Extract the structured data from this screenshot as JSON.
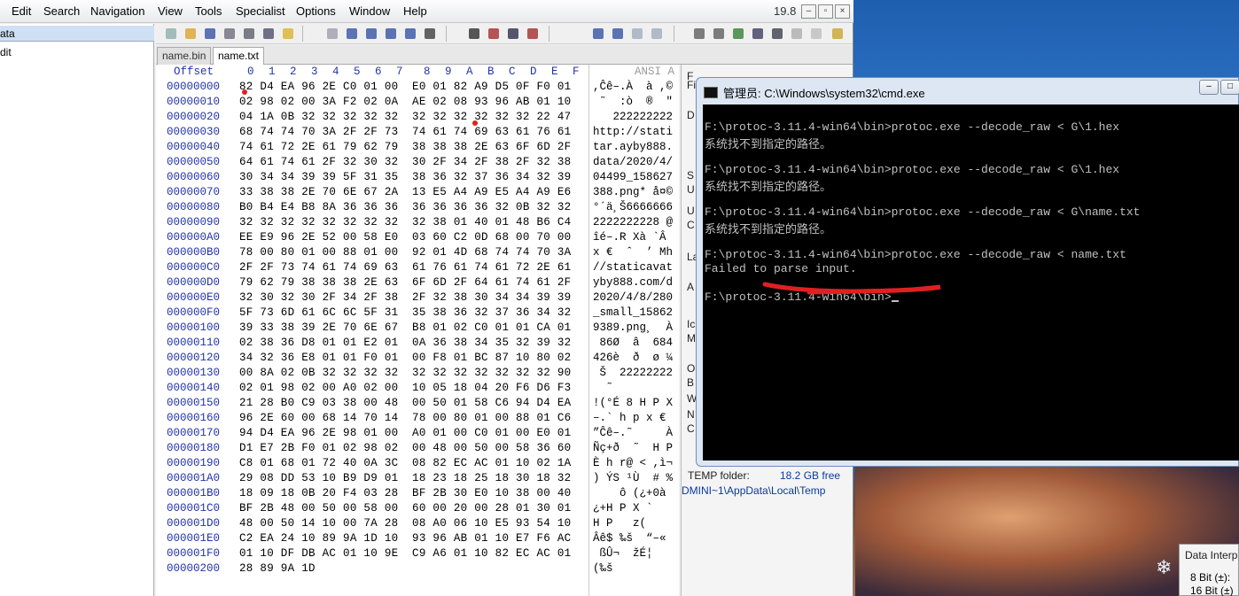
{
  "menu": [
    "Edit",
    "Search",
    "Navigation",
    "View",
    "Tools",
    "Specialist",
    "Options",
    "Window",
    "Help"
  ],
  "version": "19.8",
  "window_controls": [
    "–",
    "▫",
    "×"
  ],
  "left_panel": {
    "row1": "ata",
    "row2": "dit"
  },
  "tabs": [
    "name.bin",
    "name.txt"
  ],
  "hex": {
    "offset_header": "Offset",
    "column_headers": [
      "0",
      "1",
      "2",
      "3",
      "4",
      "5",
      "6",
      "7",
      "8",
      "9",
      "A",
      "B",
      "C",
      "D",
      "E",
      "F"
    ],
    "ansi_header": "ANSI A",
    "rows": [
      {
        "off": "00000000",
        "bytes": "82 D4 EA 96 2E C0 01 00  E0 01 82 A9 D5 0F F0 01",
        "ansi": ",Ĉê–.À  à ,©"
      },
      {
        "off": "00000010",
        "bytes": "02 98 02 00 3A F2 02 0A  AE 02 08 93 96 AB 01 10",
        "ansi": " ˜  :ò  ®  \""
      },
      {
        "off": "00000020",
        "bytes": "04 1A 0B 32 32 32 32 32  32 32 32 32 32 32 22 47",
        "ansi": "   222222222"
      },
      {
        "off": "00000030",
        "bytes": "68 74 74 70 3A 2F 2F 73  74 61 74 69 63 61 76 61",
        "ansi": "http://stati"
      },
      {
        "off": "00000040",
        "bytes": "74 61 72 2E 61 79 62 79  38 38 38 2E 63 6F 6D 2F",
        "ansi": "tar.ayby888."
      },
      {
        "off": "00000050",
        "bytes": "64 61 74 61 2F 32 30 32  30 2F 34 2F 38 2F 32 38",
        "ansi": "data/2020/4/"
      },
      {
        "off": "00000060",
        "bytes": "30 34 34 39 39 5F 31 35  38 36 32 37 36 34 32 39",
        "ansi": "04499_158627"
      },
      {
        "off": "00000070",
        "bytes": "33 38 38 2E 70 6E 67 2A  13 E5 A4 A9 E5 A4 A9 E6",
        "ansi": "388.png* å¤©"
      },
      {
        "off": "00000080",
        "bytes": "B0 B4 E4 B8 8A 36 36 36  36 36 36 36 32 0B 32 32",
        "ansi": "°´ä¸Š6666666"
      },
      {
        "off": "00000090",
        "bytes": "32 32 32 32 32 32 32 32  32 38 01 40 01 48 B6 C4",
        "ansi": "2222222228 @"
      },
      {
        "off": "000000A0",
        "bytes": "EE E9 96 2E 52 00 58 E0  03 60 C2 0D 68 00 70 00",
        "ansi": "îé–.R Xà `Â"
      },
      {
        "off": "000000B0",
        "bytes": "78 00 80 01 00 88 01 00  92 01 4D 68 74 74 70 3A",
        "ansi": "x €  ˆ  ’ Mh"
      },
      {
        "off": "000000C0",
        "bytes": "2F 2F 73 74 61 74 69 63  61 76 61 74 61 72 2E 61",
        "ansi": "//staticavat"
      },
      {
        "off": "000000D0",
        "bytes": "79 62 79 38 38 38 2E 63  6F 6D 2F 64 61 74 61 2F",
        "ansi": "yby888.com/d"
      },
      {
        "off": "000000E0",
        "bytes": "32 30 32 30 2F 34 2F 38  2F 32 38 30 34 34 39 39",
        "ansi": "2020/4/8/280"
      },
      {
        "off": "000000F0",
        "bytes": "5F 73 6D 61 6C 6C 5F 31  35 38 36 32 37 36 34 32",
        "ansi": "_small_15862"
      },
      {
        "off": "00000100",
        "bytes": "39 33 38 39 2E 70 6E 67  B8 01 02 C0 01 01 CA 01",
        "ansi": "9389.png¸  À"
      },
      {
        "off": "00000110",
        "bytes": "02 38 36 D8 01 01 E2 01  0A 36 38 34 35 32 39 32",
        "ansi": " 86Ø  â  684"
      },
      {
        "off": "00000120",
        "bytes": "34 32 36 E8 01 01 F0 01  00 F8 01 BC 87 10 80 02",
        "ansi": "426è  ð  ø ¼"
      },
      {
        "off": "00000130",
        "bytes": "00 8A 02 0B 32 32 32 32  32 32 32 32 32 32 32 90",
        "ansi": " Š  22222222"
      },
      {
        "off": "00000140",
        "bytes": "02 01 98 02 00 A0 02 00  10 05 18 04 20 F6 D6 F3",
        "ansi": "  ˜"
      },
      {
        "off": "00000150",
        "bytes": "21 28 B0 C9 03 38 00 48  00 50 01 58 C6 94 D4 EA",
        "ansi": "!(°É 8 H P X"
      },
      {
        "off": "00000160",
        "bytes": "96 2E 60 00 68 14 70 14  78 00 80 01 00 88 01 C6",
        "ansi": "–.` h p x €"
      },
      {
        "off": "00000170",
        "bytes": "94 D4 EA 96 2E 98 01 00  A0 01 00 C0 01 00 E0 01",
        "ansi": "”Ĉê–.˜     À"
      },
      {
        "off": "00000180",
        "bytes": "D1 E7 2B F0 01 02 98 02  00 48 00 50 00 58 36 60",
        "ansi": "Ñç+ð  ˜  H P"
      },
      {
        "off": "00000190",
        "bytes": "C8 01 68 01 72 40 0A 3C  08 82 EC AC 01 10 02 1A",
        "ansi": "È h r@ < ,ì¬"
      },
      {
        "off": "000001A0",
        "bytes": "29 08 DD 53 10 B9 D9 01  18 23 18 25 18 30 18 32",
        "ansi": ") ÝS ¹Ù  # %"
      },
      {
        "off": "000001B0",
        "bytes": "18 09 18 0B 20 F4 03 28  BF 2B 30 E0 10 38 00 40",
        "ansi": "    ô (¿+0à"
      },
      {
        "off": "000001C0",
        "bytes": "BF 2B 48 00 50 00 58 00  60 00 20 00 28 01 30 01",
        "ansi": "¿+H P X `"
      },
      {
        "off": "000001D0",
        "bytes": "48 00 50 14 10 00 7A 28  08 A0 06 10 E5 93 54 10",
        "ansi": "H P   z("
      },
      {
        "off": "000001E0",
        "bytes": "C2 EA 24 10 89 9A 1D 10  93 96 AB 01 10 E7 F6 AC",
        "ansi": "Âê$ ‰š  “–«"
      },
      {
        "off": "000001F0",
        "bytes": "01 10 DF DB AC 01 10 9E  C9 A6 01 10 82 EC AC 01",
        "ansi": " ßÛ¬  žÉ¦"
      },
      {
        "off": "00000200",
        "bytes": "28 89 9A 1D",
        "ansi": "(‰š"
      }
    ]
  },
  "info_panel": {
    "hints": [
      "F",
      "Fi",
      "D",
      "S",
      "U",
      "U",
      "C",
      "La",
      "A",
      "Ic",
      "M",
      "O",
      "B",
      "W",
      "N",
      "C"
    ],
    "temp_label": "TEMP folder:",
    "temp_free": "18.2 GB free",
    "temp_path": "DMINI~1\\AppData\\Local\\Temp"
  },
  "data_interpreter": {
    "title": "Data Interp",
    "line1": "8 Bit (±):",
    "line2": "16 Bit (±)"
  },
  "cmd": {
    "title": "管理员: C:\\Windows\\system32\\cmd.exe",
    "controls": [
      "–",
      "□"
    ],
    "lines": [
      {
        "text": "F:\\protoc-3.11.4-win64\\bin>protoc.exe --decode_raw < G\\1.hex",
        "zh": false
      },
      {
        "text": "系统找不到指定的路径。",
        "zh": true
      },
      {
        "text": "",
        "zh": false
      },
      {
        "text": "F:\\protoc-3.11.4-win64\\bin>protoc.exe --decode_raw < G\\1.hex",
        "zh": false
      },
      {
        "text": "系统找不到指定的路径。",
        "zh": true
      },
      {
        "text": "",
        "zh": false
      },
      {
        "text": "F:\\protoc-3.11.4-win64\\bin>protoc.exe --decode_raw < G\\name.txt",
        "zh": false
      },
      {
        "text": "系统找不到指定的路径。",
        "zh": true
      },
      {
        "text": "",
        "zh": false
      },
      {
        "text": "F:\\protoc-3.11.4-win64\\bin>protoc.exe --decode_raw < name.txt",
        "zh": false
      },
      {
        "text": "Failed to parse input.",
        "zh": false
      },
      {
        "text": "",
        "zh": false
      },
      {
        "text": "F:\\protoc-3.11.4-win64\\bin>",
        "zh": false
      }
    ]
  },
  "colors": {
    "annotation_red": "#e02020",
    "offset_blue": "#2233aa",
    "console_text": "#c0c0c0"
  }
}
